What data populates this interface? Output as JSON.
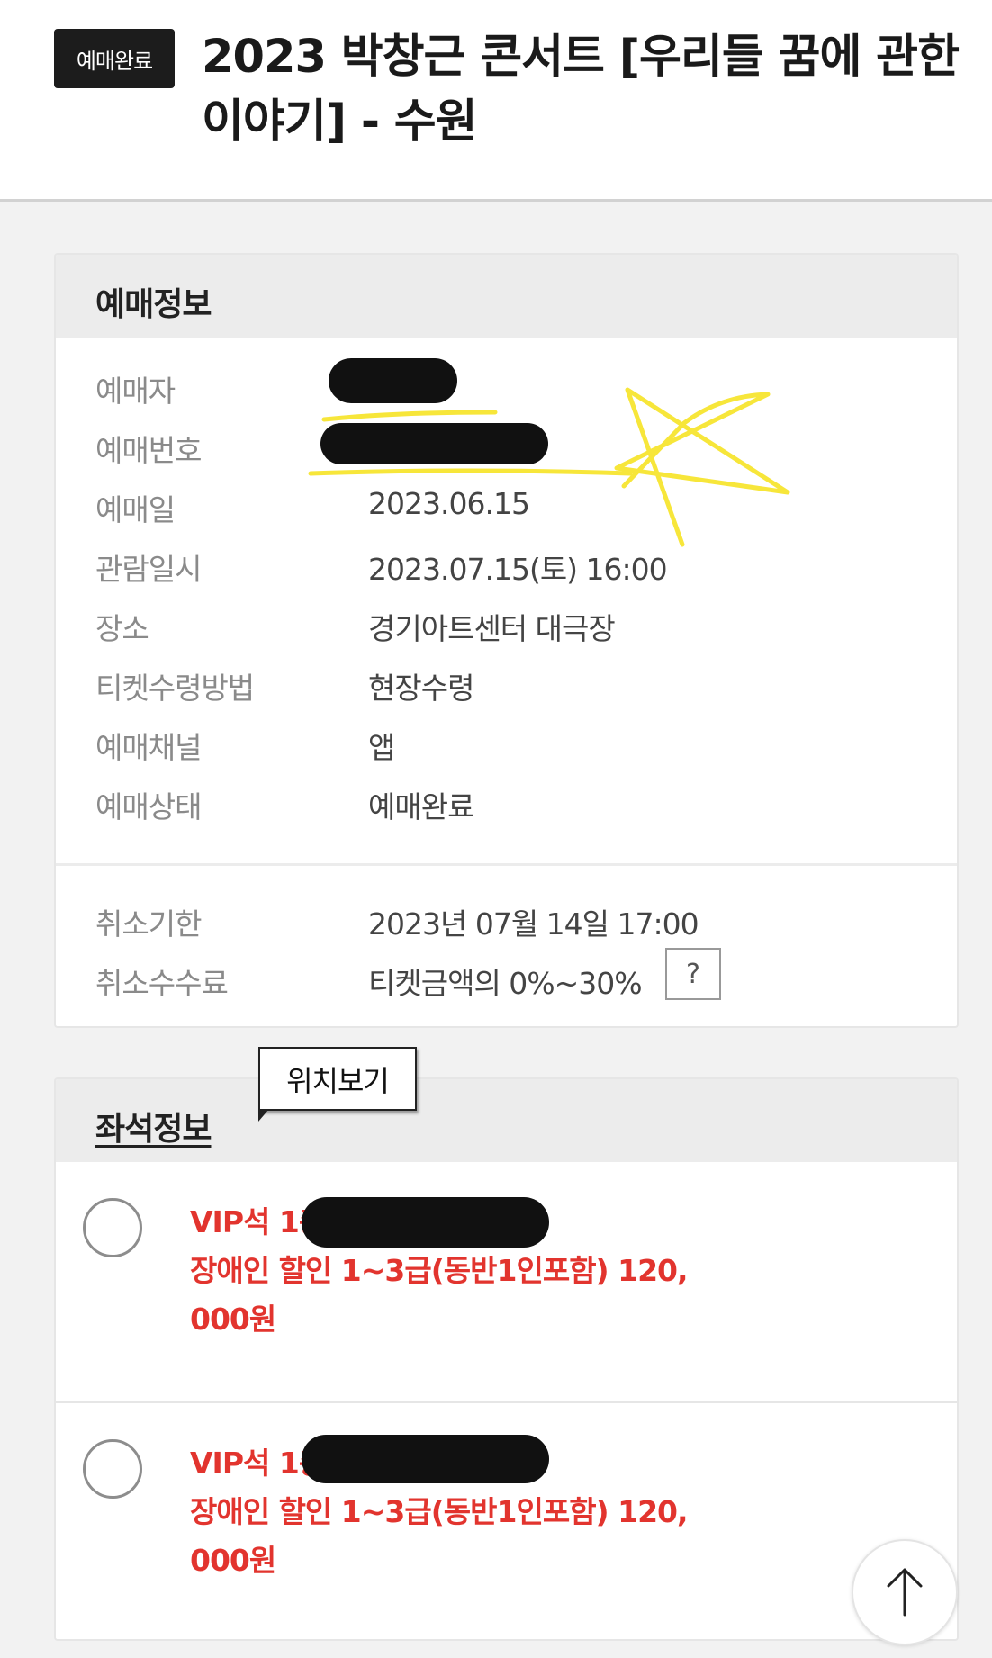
{
  "header": {
    "status_chip": "예매완료",
    "title": "2023 박창근 콘서트 [우리들 꿈에 관한 이야기] - 수원"
  },
  "booking_info": {
    "title": "예매정보",
    "rows": [
      {
        "label": "예매자",
        "value": ""
      },
      {
        "label": "예매번호",
        "value": ""
      },
      {
        "label": "예매일",
        "value": "2023.06.15"
      },
      {
        "label": "관람일시",
        "value": "2023.07.15(토) 16:00"
      },
      {
        "label": "장소",
        "value": "경기아트센터 대극장"
      },
      {
        "label": "티켓수령방법",
        "value": "현장수령"
      },
      {
        "label": "예매채널",
        "value": "앱"
      },
      {
        "label": "예매상태",
        "value": "예매완료"
      }
    ],
    "cancel": [
      {
        "label": "취소기한",
        "value": "2023년 07월 14일 17:00"
      },
      {
        "label": "취소수수료",
        "value": "티켓금액의 0%~30%"
      }
    ],
    "help_button": "?"
  },
  "seat_info": {
    "title": "좌석정보",
    "map_tooltip": "위치보기",
    "seats": [
      {
        "line1": "VIP석 1층",
        "line2": "장애인 할인 1~3급(동반1인포함) 120,",
        "line3": "000원"
      },
      {
        "line1": "VIP석 1층",
        "line2": "장애인 할인 1~3급(동반1인포함) 120,",
        "line3": "000원"
      }
    ]
  },
  "colors": {
    "accent_red": "#e2342e",
    "chip_bg": "#1c1c1c",
    "highlight_yellow": "#f7e63a"
  },
  "icons": {
    "scroll_top": "arrow-up-icon",
    "radio": "radio-circle"
  }
}
